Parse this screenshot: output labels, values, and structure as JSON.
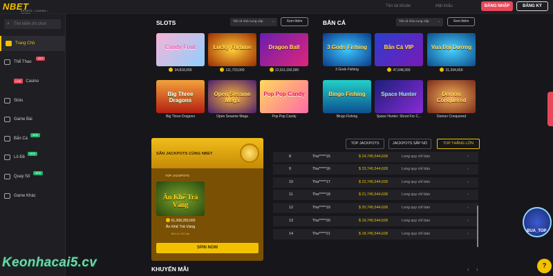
{
  "brand": {
    "logo": "NBET",
    "logo_sub": "SPORTS • CASINO • GAMES"
  },
  "header": {
    "username_placeholder": "Tên tài khoản",
    "password_placeholder": "Mật khẩu",
    "login": "ĐĂNG NHẬP",
    "register": "ĐĂNG KÝ"
  },
  "sidebar": {
    "search_placeholder": "Tìm kiếm trò chơi",
    "items": [
      {
        "label": "Trang Chủ",
        "active": true
      },
      {
        "label": "Thể Thao",
        "tag": "HOT"
      },
      {
        "label": "Casino",
        "live": "LIVE"
      },
      {
        "label": "Slots"
      },
      {
        "label": "Game Bài"
      },
      {
        "label": "Bắn Cá",
        "tag": "NEW"
      },
      {
        "label": "Lô Đề",
        "tag": "NEW"
      },
      {
        "label": "Quay Số",
        "tag": "NEW"
      },
      {
        "label": "Game Khác"
      }
    ]
  },
  "slots": {
    "title": "SLOTS",
    "provider": "Tất cả nhà cung cấp",
    "see_all": "Xem thêm",
    "games": [
      {
        "art": "Candy Fruit",
        "caption": "34,818,000"
      },
      {
        "art": "Lucky Fortune",
        "caption": "111,723,000"
      },
      {
        "art": "Dragon Ball",
        "caption": "12,011,150,000"
      },
      {
        "art": "Big Three Dragons",
        "caption": "Big Three Dragons"
      },
      {
        "art": "Open Sesame Mega",
        "caption": "Open Sesame Mega"
      },
      {
        "art": "Pop Pop Candy",
        "caption": "Pop Pop Candy"
      }
    ]
  },
  "fishing": {
    "title": "BẮN CÁ",
    "provider": "Tất cả nhà cung cấp",
    "see_all": "Xem thêm",
    "games": [
      {
        "art": "3 Gods Fishing",
        "caption": "3 Gods Fishing"
      },
      {
        "art": "Bắn Cá VIP",
        "caption": "47,048,393"
      },
      {
        "art": "Vua Đại Dương",
        "caption": "31,394,669"
      },
      {
        "art": "Bingo Fishing",
        "caption": "Bingo Fishing"
      },
      {
        "art": "Space Hunter",
        "caption": "Space Hunter: Shoot For C..."
      },
      {
        "art": "Demon Conquered",
        "caption": "Demon Conquered"
      }
    ]
  },
  "jackpot": {
    "title": "SĂN JACKPOTS CÙNG NBET",
    "sub": "TOP JACKPOTS",
    "game": {
      "art": "Ăn Khế Trả Vàng",
      "amount": "61,368,283,000",
      "name": "Ăn Khế Trả Vàng",
      "by": "Bởi sở 122 lần"
    },
    "spin": "SPIN NOW"
  },
  "jackpot_tabs": {
    "top": "TOP JACKPOTS",
    "upcoming": "JACKPOTS SẮP NỔ",
    "winners": "TOP THẮNG LỚN"
  },
  "winners": [
    {
      "rank": "8",
      "user": "Tha*****15",
      "amount": "24,745,544,628",
      "game": "Long quy chỉ bảo"
    },
    {
      "rank": "9",
      "user": "Tha*****16",
      "amount": "23,745,544,628",
      "game": "Long quy chỉ bảo"
    },
    {
      "rank": "10",
      "user": "Tha*****17",
      "amount": "22,745,544,628",
      "game": "Long quy chỉ bảo"
    },
    {
      "rank": "11",
      "user": "Tha*****18",
      "amount": "21,745,544,628",
      "game": "Long quy chỉ bảo"
    },
    {
      "rank": "12",
      "user": "Tha*****19",
      "amount": "20,745,544,628",
      "game": "Long quy chỉ bảo"
    },
    {
      "rank": "13",
      "user": "Tha*****20",
      "amount": "19,745,544,628",
      "game": "Long quy chỉ bảo"
    },
    {
      "rank": "14",
      "user": "Tha*****21",
      "amount": "18,745,544,628",
      "game": "Long quy chỉ bảo"
    }
  ],
  "promo": {
    "title": "KHUYẾN MÃI"
  },
  "watermark": "Keonhacai5.cv",
  "badge": "BUA_TOP",
  "chat_glyph": "?",
  "colors": {
    "accent": "#f2c200",
    "login": "#e8475a",
    "new": "#1fb46b"
  }
}
